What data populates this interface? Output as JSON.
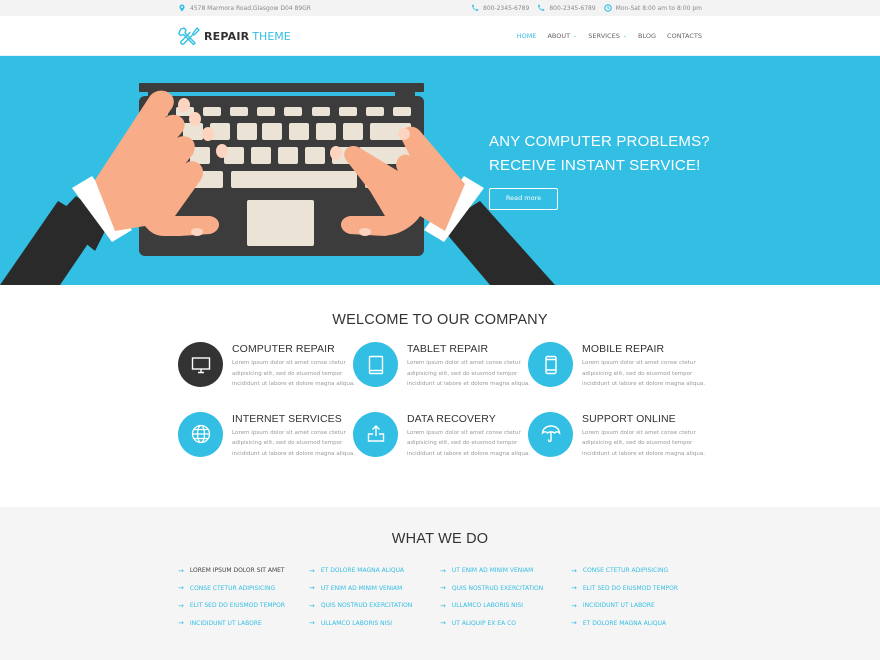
{
  "topbar": {
    "address": "4578 Marmora Road,Glasgow D04 89GR",
    "phone1": "800-2345-6789",
    "phone2": "800-2345-6789",
    "hours": "Mon-Sat 8:00 am to 8:00 pm",
    "icons": {
      "address": "map-pin-icon",
      "phone": "phone-icon",
      "hours": "clock-icon"
    }
  },
  "header": {
    "logo_bold": "REPAIR",
    "logo_light": "THEME",
    "nav": [
      {
        "label": "HOME",
        "active": true,
        "dropdown": false
      },
      {
        "label": "ABOUT",
        "active": false,
        "dropdown": true
      },
      {
        "label": "SERVICES",
        "active": false,
        "dropdown": true
      },
      {
        "label": "BLOG",
        "active": false,
        "dropdown": false
      },
      {
        "label": "CONTACTS",
        "active": false,
        "dropdown": false
      }
    ],
    "caret": "⌄"
  },
  "hero": {
    "line1": "ANY COMPUTER PROBLEMS?",
    "line2": "RECEIVE INSTANT SERVICE!",
    "button": "Read more"
  },
  "welcome": {
    "title": "WELCOME TO OUR COMPANY",
    "features": [
      {
        "title": "COMPUTER REPAIR",
        "icon": "monitor-icon",
        "text": "Lorem ipsum dolor sit amet conse ctetur adipisicing elit, sed do eiusmod tempor incididunt ut labore et dolore magna aliqua."
      },
      {
        "title": "TABLET REPAIR",
        "icon": "tablet-icon",
        "text": "Lorem ipsum dolor sit amet conse ctetur adipisicing elit, sed do eiusmod tempor incididunt ut labore et dolore magna aliqua."
      },
      {
        "title": "MOBILE REPAIR",
        "icon": "mobile-icon",
        "text": "Lorem ipsum dolor sit amet conse ctetur adipisicing elit, sed do eiusmod tempor incididunt ut labore et dolore magna aliqua."
      },
      {
        "title": "INTERNET SERVICES",
        "icon": "globe-icon",
        "text": "Lorem ipsum dolor sit amet conse ctetur adipisicing elit, sed do eiusmod tempor incididunt ut labore et dolore magna aliqua."
      },
      {
        "title": "DATA RECOVERY",
        "icon": "upload-icon",
        "text": "Lorem ipsum dolor sit amet conse ctetur adipisicing elit, sed do eiusmod tempor incididunt ut labore et dolore magna aliqua."
      },
      {
        "title": "SUPPORT ONLINE",
        "icon": "umbrella-icon",
        "text": "Lorem ipsum dolor sit amet conse ctetur adipisicing elit, sed do eiusmod tempor incididunt ut labore et dolore magna aliqua."
      }
    ]
  },
  "whatwedo": {
    "title": "WHAT WE DO",
    "arrow": "→",
    "columns": [
      [
        "LOREM IPSUM DOLOR SIT AMET",
        "CONSE CTETUR ADIPISICING",
        "ELIT SED DO EIUSMOD TEMPOR",
        "INCIDIDUNT UT LABORE"
      ],
      [
        "ET DOLORE MAGNA ALIQUA",
        "UT ENIM AD MINIM VENIAM",
        "QUIS NOSTRUD EXERCITATION",
        "ULLAMCO LABORIS NISI"
      ],
      [
        "UT ENIM AD MINIM VENIAM",
        "QUIS NOSTRUD EXERCITATION",
        "ULLAMCO LABORIS NISI",
        "UT ALIQUIP EX EA CO"
      ],
      [
        "CONSE CTETUR ADIPISICING",
        "ELIT SED DO EIUSMOD TEMPOR",
        "INCIDIDUNT UT LABORE",
        "ET DOLORE MAGNA ALIQUA"
      ]
    ]
  },
  "colors": {
    "accent": "#32bfe3",
    "dark": "#333333",
    "skin": "#f8ad88",
    "key": "#ebe3d6",
    "laptop": "#3c3c3c"
  }
}
